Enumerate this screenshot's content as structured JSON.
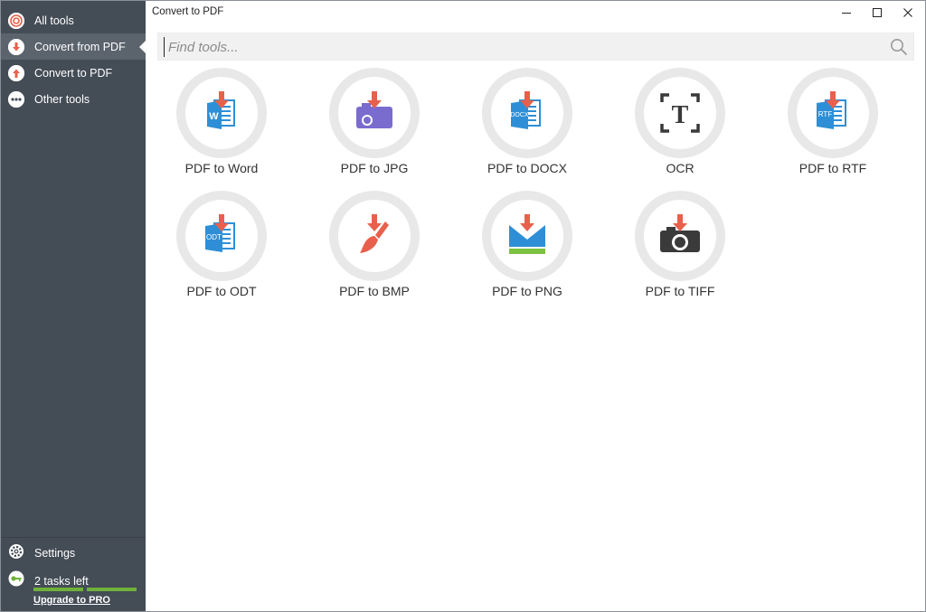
{
  "window": {
    "title": "Convert to PDF",
    "controls": [
      "minimize",
      "maximize",
      "close"
    ]
  },
  "sidebar": {
    "items": [
      {
        "label": "All tools",
        "icon": "all-tools-icon"
      },
      {
        "label": "Convert from PDF",
        "icon": "convert-from-pdf-icon",
        "active": true
      },
      {
        "label": "Convert to PDF",
        "icon": "convert-to-pdf-icon"
      },
      {
        "label": "Other tools",
        "icon": "more-icon"
      }
    ],
    "settings_label": "Settings",
    "tasks_label": "2 tasks left",
    "tasks_progress_segments": 2,
    "upgrade_label": "Upgrade to PRO"
  },
  "search": {
    "placeholder": "Find tools..."
  },
  "tools": [
    {
      "label": "PDF to Word",
      "icon": "word-document-icon",
      "badge": "W"
    },
    {
      "label": "PDF to JPG",
      "icon": "jpg-camera-icon"
    },
    {
      "label": "PDF to DOCX",
      "icon": "docx-document-icon",
      "badge": "DOCX"
    },
    {
      "label": "OCR",
      "icon": "ocr-text-scan-icon",
      "badge": "T"
    },
    {
      "label": "PDF to RTF",
      "icon": "rtf-document-icon",
      "badge": "RTF"
    },
    {
      "label": "PDF to ODT",
      "icon": "odt-document-icon",
      "badge": "ODT"
    },
    {
      "label": "PDF to BMP",
      "icon": "bmp-paintbrush-icon"
    },
    {
      "label": "PDF to PNG",
      "icon": "png-image-icon"
    },
    {
      "label": "PDF to TIFF",
      "icon": "tiff-camera-icon"
    }
  ],
  "colors": {
    "sidebar_bg": "#444c56",
    "sidebar_active": "#5b636d",
    "accent_red": "#e8604c",
    "doc_blue": "#2e8fd6",
    "jpg_purple": "#7a6bcf",
    "png_green": "#7dc242",
    "progress_green": "#6fb23a",
    "circle_gray": "#e8e8e8"
  }
}
